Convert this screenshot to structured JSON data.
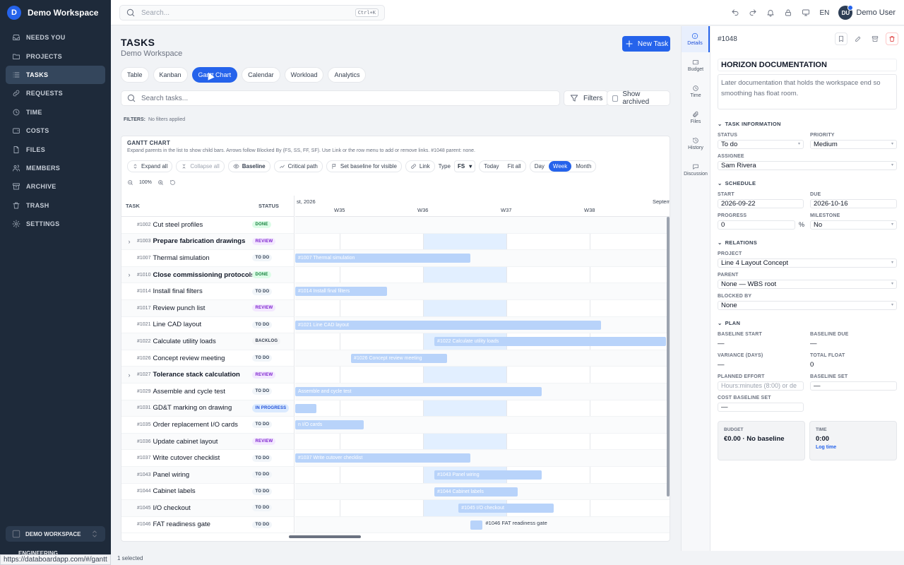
{
  "workspace": {
    "initial": "D",
    "name": "Demo Workspace"
  },
  "nav": [
    {
      "label": "Needs You",
      "icon": "inbox-icon"
    },
    {
      "label": "Projects",
      "icon": "folder-icon"
    },
    {
      "label": "Tasks",
      "icon": "list-icon",
      "active": true
    },
    {
      "label": "Requests",
      "icon": "link-icon"
    },
    {
      "label": "Time",
      "icon": "clock-icon"
    },
    {
      "label": "Costs",
      "icon": "wallet-icon"
    },
    {
      "label": "Files",
      "icon": "file-icon"
    },
    {
      "label": "Members",
      "icon": "users-icon"
    },
    {
      "label": "Archive",
      "icon": "archive-icon"
    },
    {
      "label": "Trash",
      "icon": "trash-icon"
    },
    {
      "label": "Settings",
      "icon": "gear-icon"
    }
  ],
  "ws_switcher": {
    "label": "DEMO WORKSPACE",
    "sub": "ENGINEERING"
  },
  "topbar": {
    "search_placeholder": "Search...",
    "shortcut": "Ctrl+K",
    "lang": "EN",
    "user_initials": "DU",
    "user_name": "Demo User"
  },
  "page": {
    "title": "TASKS",
    "subtitle": "Demo Workspace",
    "new_task": "New Task"
  },
  "view_tabs": [
    {
      "label": "Table"
    },
    {
      "label": "Kanban"
    },
    {
      "label": "Gantt Chart",
      "active": true
    },
    {
      "label": "Calendar"
    },
    {
      "label": "Workload"
    },
    {
      "label": "Analytics"
    }
  ],
  "task_search_placeholder": "Search tasks...",
  "filters_label": "Filters",
  "show_archived": "Show archived",
  "filters_line": {
    "key": "FILTERS:",
    "value": "No filters applied"
  },
  "gantt": {
    "title": "GANTT CHART",
    "desc": "Expand parents in the list to show child bars. Arrows follow Blocked By (FS, SS, FF, SF). Use Link or the row menu to add or remove links. #1048 parent: none.",
    "tools": {
      "expand_all": "Expand all",
      "collapse_all": "Collapse all",
      "baseline": "Baseline",
      "critical_path": "Critical path",
      "set_baseline": "Set baseline for visible",
      "link": "Link",
      "type_label": "Type",
      "type_value": "FS",
      "today": "Today",
      "fit_all": "Fit all"
    },
    "scale": [
      "Day",
      "Week",
      "Month"
    ],
    "scale_active": "Week",
    "zoom": "100%",
    "col_task": "TASK",
    "col_status": "STATUS",
    "month_left": "st, 2026",
    "month_right": "Septem",
    "weeks": [
      "W35",
      "W36",
      "W37",
      "W38",
      "W"
    ]
  },
  "tasks": [
    {
      "id": "#1002",
      "name": "Cut steel profiles",
      "status": "DONE",
      "cls": "b-done",
      "bold": false,
      "expand": false,
      "bar": null
    },
    {
      "id": "#1003",
      "name": "Prepare fabrication drawings",
      "status": "REVIEW",
      "cls": "b-review",
      "bold": true,
      "expand": true,
      "bar": null
    },
    {
      "id": "#1007",
      "name": "Thermal simulation",
      "status": "TO DO",
      "cls": "b-todo",
      "bold": false,
      "expand": false,
      "bar": {
        "label": "#1007 Thermal simulation",
        "start": 0,
        "end": 2.1
      }
    },
    {
      "id": "#1010",
      "name": "Close commissioning protocols",
      "status": "DONE",
      "cls": "b-done",
      "bold": true,
      "expand": true,
      "bar": null
    },
    {
      "id": "#1014",
      "name": "Install final filters",
      "status": "TO DO",
      "cls": "b-todo",
      "bold": false,
      "expand": false,
      "bar": {
        "label": "#1014 Install final filters",
        "start": 0,
        "end": 1.1
      }
    },
    {
      "id": "#1017",
      "name": "Review punch list",
      "status": "REVIEW",
      "cls": "b-review",
      "bold": false,
      "expand": false,
      "bar": null
    },
    {
      "id": "#1021",
      "name": "Line CAD layout",
      "status": "TO DO",
      "cls": "b-todo",
      "bold": false,
      "expand": false,
      "bar": {
        "label": "#1021 Line CAD layout",
        "start": 0,
        "end": 3.67
      }
    },
    {
      "id": "#1022",
      "name": "Calculate utility loads",
      "status": "BACKLOG",
      "cls": "b-backlog",
      "bold": false,
      "expand": false,
      "bar": {
        "label": "#1022 Calculate utility loads",
        "start": 1.67,
        "end": 4.45
      }
    },
    {
      "id": "#1026",
      "name": "Concept review meeting",
      "status": "TO DO",
      "cls": "b-todo",
      "bold": false,
      "expand": false,
      "bar": {
        "label": "#1026 Concept review meeting",
        "start": 0.67,
        "end": 1.82
      }
    },
    {
      "id": "#1027",
      "name": "Tolerance stack calculation",
      "status": "REVIEW",
      "cls": "b-review",
      "bold": true,
      "expand": true,
      "bar": null
    },
    {
      "id": "#1029",
      "name": "Assemble and cycle test",
      "status": "TO DO",
      "cls": "b-todo",
      "bold": false,
      "expand": false,
      "bar": {
        "label": "Assemble and cycle test",
        "start": 0,
        "end": 2.96
      }
    },
    {
      "id": "#1031",
      "name": "GD&T marking on drawing",
      "status": "IN PROGRESS",
      "cls": "b-prog",
      "bold": false,
      "expand": false,
      "bar": {
        "label": "",
        "start": 0,
        "end": 0.25
      }
    },
    {
      "id": "#1035",
      "name": "Order replacement I/O cards",
      "status": "TO DO",
      "cls": "b-todo",
      "bold": false,
      "expand": false,
      "bar": {
        "label": "n I/O cards",
        "start": 0,
        "end": 0.82
      }
    },
    {
      "id": "#1036",
      "name": "Update cabinet layout",
      "status": "REVIEW",
      "cls": "b-review",
      "bold": false,
      "expand": false,
      "bar": null
    },
    {
      "id": "#1037",
      "name": "Write cutover checklist",
      "status": "TO DO",
      "cls": "b-todo",
      "bold": false,
      "expand": false,
      "bar": {
        "label": "#1037 Write cutover checklist",
        "start": 0,
        "end": 2.1
      }
    },
    {
      "id": "#1043",
      "name": "Panel wiring",
      "status": "TO DO",
      "cls": "b-todo",
      "bold": false,
      "expand": false,
      "bar": {
        "label": "#1043 Panel wiring",
        "start": 1.67,
        "end": 2.96
      }
    },
    {
      "id": "#1044",
      "name": "Cabinet labels",
      "status": "TO DO",
      "cls": "b-todo",
      "bold": false,
      "expand": false,
      "bar": {
        "label": "#1044 Cabinet labels",
        "start": 1.67,
        "end": 2.67
      }
    },
    {
      "id": "#1045",
      "name": "I/O checkout",
      "status": "TO DO",
      "cls": "b-todo",
      "bold": false,
      "expand": false,
      "bar": {
        "label": "#1045 I/O checkout",
        "start": 1.96,
        "end": 3.1
      }
    },
    {
      "id": "#1046",
      "name": "FAT readiness gate",
      "status": "TO DO",
      "cls": "b-todo",
      "bold": false,
      "expand": false,
      "bar": {
        "label": "#1046 FAT readiness gate",
        "start": 2.1,
        "end": 2.25,
        "outside": true
      }
    }
  ],
  "rail": [
    {
      "label": "Details",
      "icon": "info-icon",
      "active": true
    },
    {
      "label": "Budget",
      "icon": "wallet-icon"
    },
    {
      "label": "Time",
      "icon": "clock-icon"
    },
    {
      "label": "Files",
      "icon": "paperclip-icon"
    },
    {
      "label": "History",
      "icon": "history-icon"
    },
    {
      "label": "Discussion",
      "icon": "chat-icon"
    }
  ],
  "detail": {
    "id": "#1048",
    "title": "HORIZON DOCUMENTATION",
    "description": "Later documentation that holds the workspace end so smoothing has float room.",
    "sec_info": "TASK INFORMATION",
    "status_label": "STATUS",
    "status_value": "To do",
    "priority_label": "PRIORITY",
    "priority_value": "Medium",
    "assignee_label": "ASSIGNEE",
    "assignee_value": "Sam Rivera",
    "sec_schedule": "SCHEDULE",
    "start_label": "START",
    "start_value": "2026-09-22",
    "due_label": "DUE",
    "due_value": "2026-10-16",
    "progress_label": "PROGRESS",
    "progress_value": "0",
    "progress_unit": "%",
    "milestone_label": "MILESTONE",
    "milestone_value": "No",
    "sec_relations": "RELATIONS",
    "project_label": "PROJECT",
    "project_value": "Line 4 Layout Concept",
    "parent_label": "PARENT",
    "parent_value": "None — WBS root",
    "blocked_label": "BLOCKED BY",
    "blocked_value": "None",
    "sec_plan": "PLAN",
    "bstart_label": "BASELINE START",
    "bstart_value": "—",
    "bdue_label": "BASELINE DUE",
    "bdue_value": "—",
    "var_label": "VARIANCE (DAYS)",
    "var_value": "—",
    "float_label": "TOTAL FLOAT",
    "float_value": "0",
    "effort_label": "PLANNED EFFORT",
    "effort_placeholder": "Hours:minutes (8:00) or de",
    "bset_label": "BASELINE SET",
    "bset_value": "—",
    "cbset_label": "COST BASELINE SET",
    "cbset_value": "—",
    "budget_label": "BUDGET",
    "budget_value": "€0.00 · No baseline",
    "time_label": "TIME",
    "time_value": "0:00",
    "time_link": "Log time"
  },
  "status_bar": {
    "url": "https://databoardapp.com/#/gantt",
    "selected": "1 selected"
  }
}
